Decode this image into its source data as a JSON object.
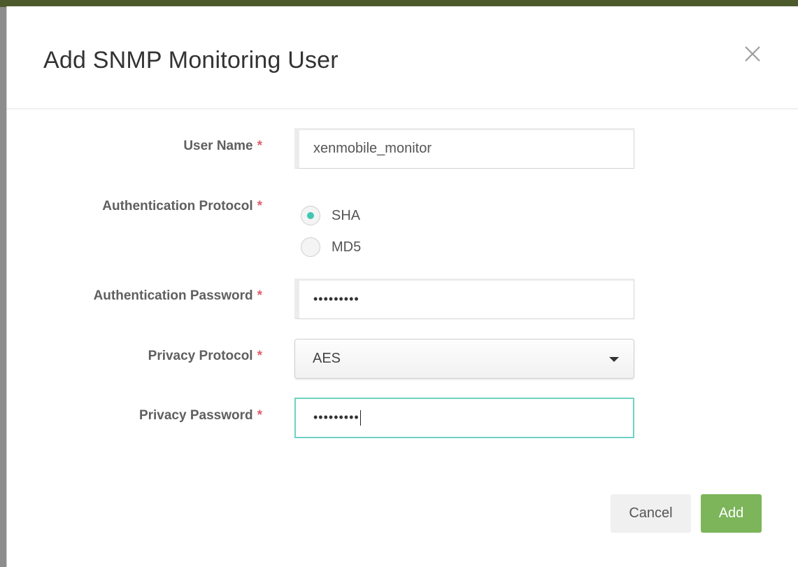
{
  "dialog": {
    "title": "Add SNMP Monitoring User",
    "close_icon": "close-icon"
  },
  "form": {
    "required_marker": "*",
    "user_name": {
      "label": "User Name",
      "value": "xenmobile_monitor"
    },
    "auth_protocol": {
      "label": "Authentication Protocol",
      "options": [
        "SHA",
        "MD5"
      ],
      "selected": "SHA"
    },
    "auth_password": {
      "label": "Authentication Password",
      "masked_value": "•••••••••"
    },
    "privacy_protocol": {
      "label": "Privacy Protocol",
      "value": "AES"
    },
    "privacy_password": {
      "label": "Privacy Password",
      "masked_value": "•••••••••"
    }
  },
  "footer": {
    "cancel_label": "Cancel",
    "add_label": "Add"
  },
  "colors": {
    "accent_teal": "#41c6b0",
    "add_button": "#7cb55a",
    "required": "#e06070"
  }
}
